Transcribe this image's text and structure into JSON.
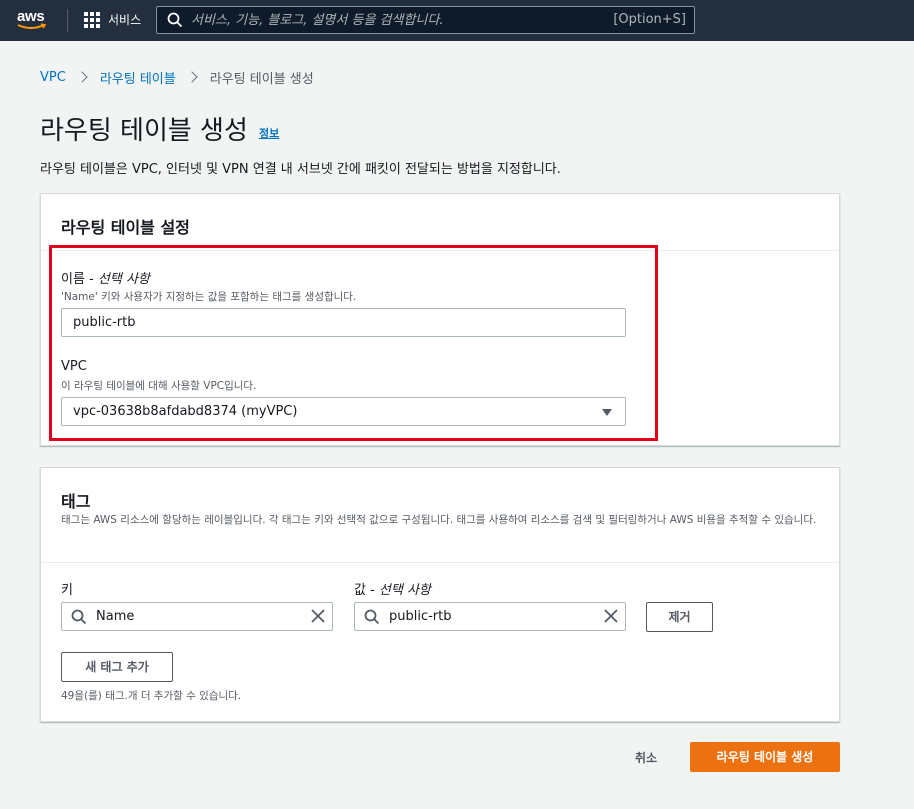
{
  "nav": {
    "logo_text": "aws",
    "services_label": "서비스",
    "search_placeholder": "서비스, 기능, 블로그, 설명서 등을 검색합니다.",
    "search_shortcut": "[Option+S]"
  },
  "breadcrumb": {
    "items": [
      "VPC",
      "라우팅 테이블"
    ],
    "current": "라우팅 테이블 생성"
  },
  "page": {
    "title": "라우팅 테이블 생성",
    "info_link": "정보",
    "description": "라우팅 테이블은 VPC, 인터넷 및 VPN 연결 내 서브넷 간에 패킷이 전달되는 방법을 지정합니다."
  },
  "settings": {
    "title": "라우팅 테이블 설정",
    "name_label": "이름 - ",
    "name_optional": "선택 사항",
    "name_desc": "'Name' 키와 사용자가 지정하는 값을 포함하는 태그를 생성합니다.",
    "name_value": "public-rtb",
    "vpc_label": "VPC",
    "vpc_desc": "이 라우팅 테이블에 대해 사용할 VPC입니다.",
    "vpc_value": "vpc-03638b8afdabd8374 (myVPC)"
  },
  "tags": {
    "title": "태그",
    "description": "태그는 AWS 리소스에 할당하는 레이블입니다. 각 태그는 키와 선택적 값으로 구성됩니다. 태그를 사용하여 리소스를 검색 및 필터링하거나 AWS 비용을 추적할 수 있습니다.",
    "key_label": "키",
    "value_label": "값 - ",
    "value_optional": "선택 사항",
    "rows": [
      {
        "key": "Name",
        "value": "public-rtb"
      }
    ],
    "remove_label": "제거",
    "add_label": "새 태그 추가",
    "remaining_note": "49을(를) 태그.개 더 추가할 수 있습니다."
  },
  "footer": {
    "cancel_label": "취소",
    "create_label": "라우팅 테이블 생성"
  },
  "colors": {
    "nav_bg": "#232f3e",
    "link": "#0073bb",
    "primary": "#ec7211",
    "highlight": "#e3001b"
  }
}
